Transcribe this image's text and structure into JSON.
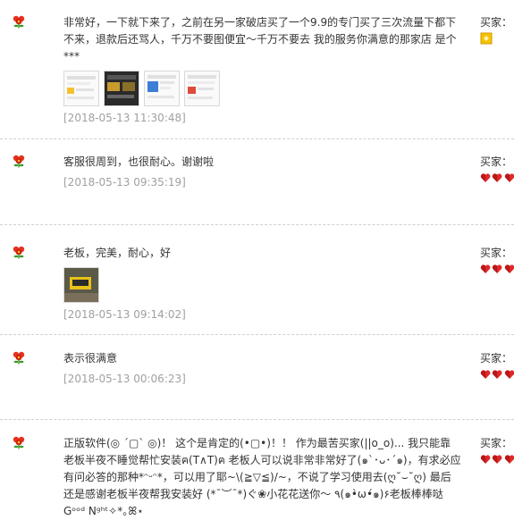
{
  "reviews": [
    {
      "text": "非常好，一下就下来了，之前在另一家破店买了一个9.9的专门买了三次流量下都下不来，退款后还骂人，千万不要图便宜～千万不要去 我的服务你满意的那家店 是个***",
      "date": "[2018-05-13 11:30:48]",
      "buyer_label": "买家：",
      "badge_icon": "diamond-yellow-icon",
      "badge_count": 1,
      "thumbnails": [
        "phone-screenshot-thumb",
        "phone-screenshot-thumb",
        "phone-screenshot-thumb",
        "phone-screenshot-thumb"
      ]
    },
    {
      "text": "客服很周到，也很耐心。谢谢啦",
      "date": "[2018-05-13 09:35:19]",
      "buyer_label": "买家：",
      "badge_icon": "red-heart-icon",
      "badge_count": 3,
      "thumbnails": []
    },
    {
      "text": "老板，完美，耐心，好",
      "date": "[2018-05-13 09:14:02]",
      "buyer_label": "买家：",
      "badge_icon": "red-heart-icon",
      "badge_count": 3,
      "thumbnails": [
        "device-photo-thumb"
      ]
    },
    {
      "text": "表示很满意",
      "date": "[2018-05-13 00:06:23]",
      "buyer_label": "买家：",
      "badge_icon": "red-heart-icon",
      "badge_count": 3,
      "thumbnails": []
    },
    {
      "text": "正版软件(◎ ´▢` ◎)！ 这个是肯定的(•▢•)！！ 作为最苦买家(||o_o)... 我只能靠老板半夜不睡觉帮忙安装ฅ(T∧T)ฅ 老板人可以说非常非常好了(๑`･ᴗ･´๑)，有求必应有问必答的那种*ᵔᵕᵔ*，可以用了耶~\\(≧▽≦)/~，不说了学习使用去(ღ˘⌣˘ღ) 最后还是感谢老板半夜帮我安装好 (*¯︶¯*)ぐ❀小花花送你～ ٩(๑•̀ω•́๑)۶老板棒棒哒 Gᵒᵒᵈ Nᵍʰᵗ✧*｡ꕤ⋆",
      "date": "",
      "buyer_label": "买家：",
      "badge_icon": "red-heart-icon",
      "badge_count": 3,
      "thumbnails": []
    }
  ]
}
